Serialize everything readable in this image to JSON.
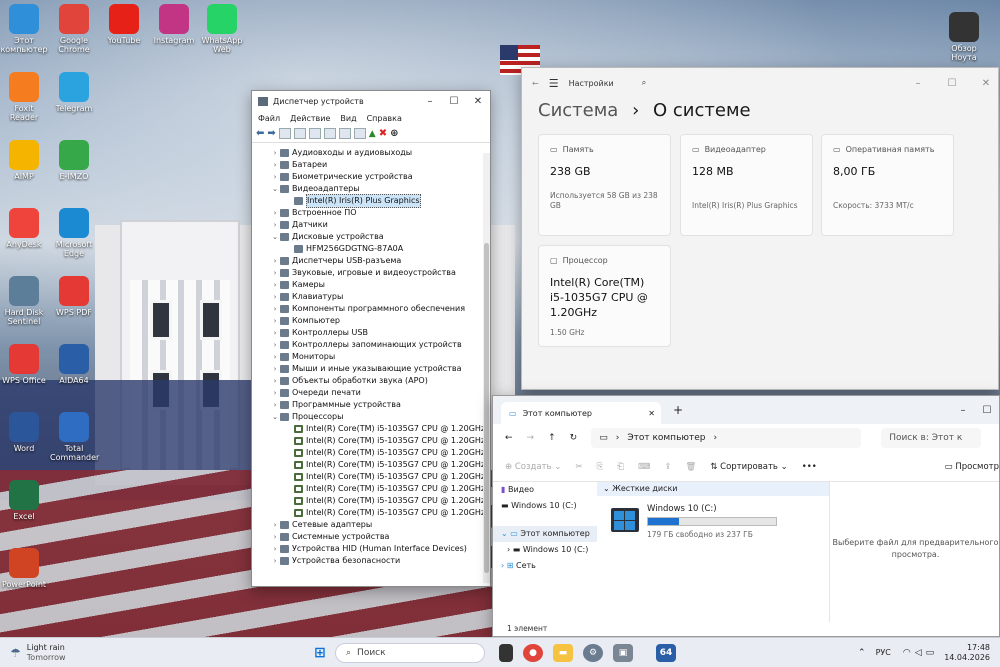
{
  "desktop": {
    "icons": [
      {
        "label": "Этот компьютер",
        "icon": "monitor-icon",
        "color": "#2f8fd8"
      },
      {
        "label": "Google Chrome",
        "icon": "chrome-icon",
        "color": "#e0443a"
      },
      {
        "label": "YouTube",
        "icon": "youtube-icon",
        "color": "#e62117"
      },
      {
        "label": "Instagram",
        "icon": "instagram-icon",
        "color": "#c13584"
      },
      {
        "label": "WhatsApp Web",
        "icon": "whatsapp-icon",
        "color": "#25d366"
      },
      {
        "label": "Foxit Reader",
        "icon": "pdf-icon",
        "color": "#f57c1f"
      },
      {
        "label": "Telegram",
        "icon": "telegram-icon",
        "color": "#2aa3df"
      },
      {
        "label": "AIMP",
        "icon": "aimp-icon",
        "color": "#f4b400"
      },
      {
        "label": "E-IMZO",
        "icon": "eimzo-icon",
        "color": "#37a84a"
      },
      {
        "label": "AnyDesk",
        "icon": "anydesk-icon",
        "color": "#ef443b"
      },
      {
        "label": "Microsoft Edge",
        "icon": "edge-icon",
        "color": "#1b8ad3"
      },
      {
        "label": "Hard Disk Sentinel",
        "icon": "hdd-icon",
        "color": "#5c7e98"
      },
      {
        "label": "WPS PDF",
        "icon": "wps-pdf-icon",
        "color": "#e53935"
      },
      {
        "label": "WPS Office",
        "icon": "wps-office-icon",
        "color": "#e53935"
      },
      {
        "label": "AIDA64",
        "icon": "aida64-icon",
        "color": "#2a5fa8"
      },
      {
        "label": "Word",
        "icon": "word-icon",
        "color": "#2b579a"
      },
      {
        "label": "Total Commander",
        "icon": "floppy-icon",
        "color": "#2f6dc2"
      },
      {
        "label": "Excel",
        "icon": "excel-icon",
        "color": "#217346"
      },
      {
        "label": "PowerPoint",
        "icon": "powerpoint-icon",
        "color": "#d04423"
      },
      {
        "label": "Обзор Ноута",
        "icon": "video-icon",
        "color": "#333333"
      }
    ]
  },
  "device_manager": {
    "title": "Диспетчер устройств",
    "menu": [
      "Файл",
      "Действие",
      "Вид",
      "Справка"
    ],
    "tree": [
      {
        "label": "Аудиовходы и аудиовыходы",
        "level": 0,
        "exp": "›"
      },
      {
        "label": "Батареи",
        "level": 0,
        "exp": "›"
      },
      {
        "label": "Биометрические устройства",
        "level": 0,
        "exp": "›"
      },
      {
        "label": "Видеоадаптеры",
        "level": 0,
        "exp": "⌄"
      },
      {
        "label": "Intel(R) Iris(R) Plus Graphics",
        "level": 1,
        "exp": "",
        "sel": true
      },
      {
        "label": "Встроенное ПО",
        "level": 0,
        "exp": "›"
      },
      {
        "label": "Датчики",
        "level": 0,
        "exp": "›"
      },
      {
        "label": "Дисковые устройства",
        "level": 0,
        "exp": "⌄"
      },
      {
        "label": "HFM256GDGTNG-87A0A",
        "level": 1,
        "exp": ""
      },
      {
        "label": "Диспетчеры USB-разъема",
        "level": 0,
        "exp": "›"
      },
      {
        "label": "Звуковые, игровые и видеоустройства",
        "level": 0,
        "exp": "›"
      },
      {
        "label": "Камеры",
        "level": 0,
        "exp": "›"
      },
      {
        "label": "Клавиатуры",
        "level": 0,
        "exp": "›"
      },
      {
        "label": "Компоненты программного обеспечения",
        "level": 0,
        "exp": "›"
      },
      {
        "label": "Компьютер",
        "level": 0,
        "exp": "›"
      },
      {
        "label": "Контроллеры USB",
        "level": 0,
        "exp": "›"
      },
      {
        "label": "Контроллеры запоминающих устройств",
        "level": 0,
        "exp": "›"
      },
      {
        "label": "Мониторы",
        "level": 0,
        "exp": "›"
      },
      {
        "label": "Мыши и иные указывающие устройства",
        "level": 0,
        "exp": "›"
      },
      {
        "label": "Объекты обработки звука (APO)",
        "level": 0,
        "exp": "›"
      },
      {
        "label": "Очереди печати",
        "level": 0,
        "exp": "›"
      },
      {
        "label": "Программные устройства",
        "level": 0,
        "exp": "›"
      },
      {
        "label": "Процессоры",
        "level": 0,
        "exp": "⌄"
      },
      {
        "label": "Intel(R) Core(TM) i5-1035G7 CPU @ 1.20GHz",
        "level": 1,
        "exp": "",
        "cpu": true
      },
      {
        "label": "Intel(R) Core(TM) i5-1035G7 CPU @ 1.20GHz",
        "level": 1,
        "exp": "",
        "cpu": true
      },
      {
        "label": "Intel(R) Core(TM) i5-1035G7 CPU @ 1.20GHz",
        "level": 1,
        "exp": "",
        "cpu": true
      },
      {
        "label": "Intel(R) Core(TM) i5-1035G7 CPU @ 1.20GHz",
        "level": 1,
        "exp": "",
        "cpu": true
      },
      {
        "label": "Intel(R) Core(TM) i5-1035G7 CPU @ 1.20GHz",
        "level": 1,
        "exp": "",
        "cpu": true
      },
      {
        "label": "Intel(R) Core(TM) i5-1035G7 CPU @ 1.20GHz",
        "level": 1,
        "exp": "",
        "cpu": true
      },
      {
        "label": "Intel(R) Core(TM) i5-1035G7 CPU @ 1.20GHz",
        "level": 1,
        "exp": "",
        "cpu": true
      },
      {
        "label": "Intel(R) Core(TM) i5-1035G7 CPU @ 1.20GHz",
        "level": 1,
        "exp": "",
        "cpu": true
      },
      {
        "label": "Сетевые адаптеры",
        "level": 0,
        "exp": "›"
      },
      {
        "label": "Системные устройства",
        "level": 0,
        "exp": "›"
      },
      {
        "label": "Устройства HID (Human Interface Devices)",
        "level": 0,
        "exp": "›"
      },
      {
        "label": "Устройства безопасности",
        "level": 0,
        "exp": "›"
      }
    ]
  },
  "settings": {
    "app_title": "Настройки",
    "crumb_parent": "Система",
    "crumb_sep": "›",
    "crumb_current": "О системе",
    "cards": {
      "memory": {
        "label": "Память",
        "value": "238 GB",
        "sub": "Используется 58 GB из 238 GB"
      },
      "gpu": {
        "label": "Видеоадаптер",
        "value": "128 MB",
        "sub": "Intel(R) Iris(R) Plus Graphics"
      },
      "ram": {
        "label": "Оперативная память",
        "value": "8,00 ГБ",
        "sub": "Скорость: 3733 МТ/с"
      },
      "cpu": {
        "label": "Процессор",
        "value": "Intel(R) Core(TM) i5-1035G7 CPU @ 1.20GHz",
        "sub": "1.50 GHz"
      }
    }
  },
  "explorer": {
    "tab_title": "Этот компьютер",
    "address": "Этот компьютер",
    "search_placeholder": "Поиск в: Этот к",
    "cmd": {
      "create": "Создать",
      "sort": "Сортировать",
      "more": "•••",
      "preview": "Просмотр"
    },
    "nav": {
      "video": "Видео",
      "win1": "Windows 10 (C:)",
      "pc": "Этот компьютер",
      "win2": "Windows 10 (C:)",
      "net": "Сеть"
    },
    "group": "Жесткие диски",
    "drive": {
      "name": "Windows 10 (C:)",
      "free": "179 ГБ свободно из 237 ГБ",
      "used_fraction": 0.245
    },
    "preview_hint": "Выберите файл для предварительного просмотра.",
    "status": "1 элемент"
  },
  "taskbar": {
    "weather_title": "Light rain",
    "weather_sub": "Tomorrow",
    "search": "Поиск",
    "lang": "РУС",
    "time": "17:48",
    "date": "14.04.2026"
  }
}
